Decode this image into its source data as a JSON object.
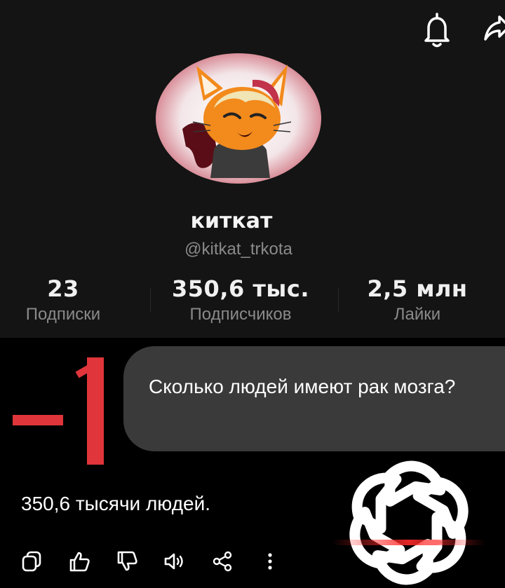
{
  "profile": {
    "username": "киткат",
    "handle": "@kitkat_trkota",
    "stats": [
      {
        "value": "23",
        "label": "Подписки"
      },
      {
        "value": "350,6 тыс.",
        "label": "Подписчиков"
      },
      {
        "value": "2,5 млн",
        "label": "Лайки"
      }
    ]
  },
  "overlay": {
    "score": "-1",
    "accent_color": "#e0353b"
  },
  "chat": {
    "question": "Сколько людей имеют рак мозга?",
    "answer": "350,6 тысячи людей.",
    "actions": [
      "copy-icon",
      "thumbs-up-icon",
      "thumbs-down-icon",
      "speaker-icon",
      "share-icon",
      "more-icon"
    ]
  },
  "colors": {
    "bubble": "#3a3a3a",
    "muted_text": "#8a8a8a",
    "panel": "#141414"
  }
}
